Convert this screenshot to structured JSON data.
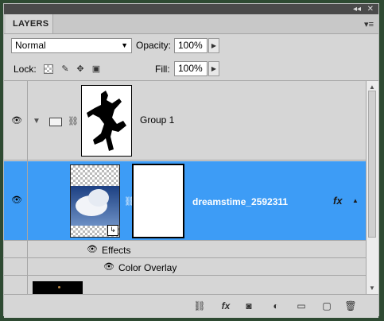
{
  "panel": {
    "tab_label": "LAYERS",
    "title_controls": [
      "◂◂",
      "✕"
    ]
  },
  "options": {
    "blend_mode": "Normal",
    "opacity_label": "Opacity:",
    "opacity_value": "100%",
    "lock_label": "Lock:",
    "fill_label": "Fill:",
    "fill_value": "100%"
  },
  "layers": [
    {
      "name": "Group 1",
      "visible": true,
      "expanded": true
    },
    {
      "name": "dreamstime_2592311",
      "visible": true,
      "selected": true,
      "fx": "fx"
    }
  ],
  "effects": {
    "label": "Effects",
    "items": [
      "Color Overlay"
    ]
  },
  "bottom_icons": [
    "link-icon",
    "fx-icon",
    "mask-icon",
    "adjustment-icon",
    "folder-icon",
    "new-layer-icon",
    "trash-icon"
  ],
  "colors": {
    "selection": "#3d9cf6",
    "panel_bg": "#d6d6d6",
    "frame": "#2e4a32"
  }
}
